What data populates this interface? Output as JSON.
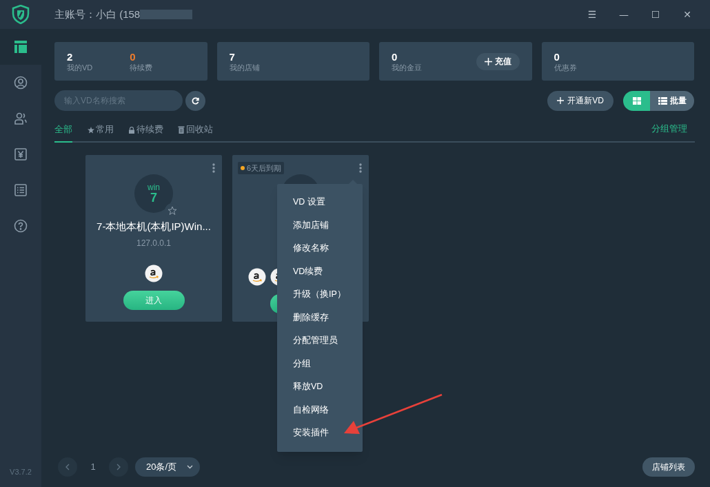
{
  "window": {
    "title": "主账号：小白 (158",
    "controls": [
      "☰",
      "—",
      "☐",
      "✕"
    ]
  },
  "sidebar": {
    "items": [
      {
        "selected": true
      },
      {
        "selected": false
      },
      {
        "selected": false
      },
      {
        "selected": false
      },
      {
        "selected": false
      },
      {
        "selected": false
      }
    ],
    "version": "V3.7.2"
  },
  "stats": [
    {
      "items": [
        {
          "value": "2",
          "label": "我的VD",
          "accent": false
        },
        {
          "value": "0",
          "label": "待续费",
          "accent": true
        }
      ]
    },
    {
      "items": [
        {
          "value": "7",
          "label": "我的店铺",
          "accent": false
        }
      ]
    },
    {
      "items": [
        {
          "value": "0",
          "label": "我的金豆",
          "accent": false
        }
      ],
      "button": "充值"
    },
    {
      "items": [
        {
          "value": "0",
          "label": "优惠券",
          "accent": false
        }
      ]
    }
  ],
  "search": {
    "placeholder": "输入VD名称搜索"
  },
  "new_vd_button": "开通新VD",
  "view_toggle": [
    {
      "kind": "grid",
      "selected": true
    },
    {
      "kind": "list",
      "label": "批量",
      "selected": false
    }
  ],
  "tabs": [
    {
      "label": "全部",
      "selected": true
    },
    {
      "label": "常用",
      "selected": false
    },
    {
      "label": "待续费",
      "selected": false
    },
    {
      "label": "回收站",
      "selected": false
    }
  ],
  "group_manage": "分组管理",
  "vds": [
    {
      "os_top": "win",
      "os_num": "7",
      "name": "7-本地本机(本机IP)Win...",
      "ip": "127.0.0.1",
      "stores": [
        {
          "kind": "amazon"
        }
      ],
      "button": "进入"
    },
    {
      "badge": "6天后到期",
      "stores": [
        {
          "kind": "amazon"
        },
        {
          "kind": "amazon"
        }
      ]
    }
  ],
  "menu": {
    "items": [
      "VD 设置",
      "添加店铺",
      "修改名称",
      "VD续费",
      "升级（换IP）",
      "删除缓存",
      "分配管理员",
      "分组",
      "释放VD",
      "自检网络",
      "安装插件"
    ]
  },
  "pagination": {
    "page": "1",
    "page_size": "20条/页"
  },
  "store_list_button": "店铺列表"
}
